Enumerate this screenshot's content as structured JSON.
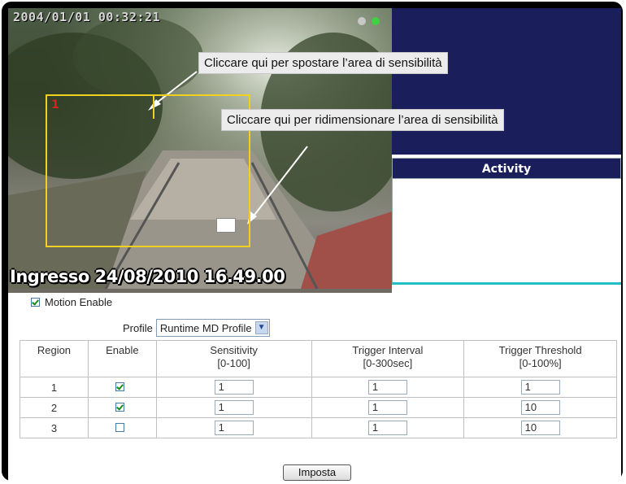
{
  "camera": {
    "timestamp": "2004/01/01 00:32:21",
    "caption": "Ingresso 24/08/2010 16.49.00",
    "region_number": "1"
  },
  "callouts": {
    "move": "Cliccare qui per spostare l’area di sensibilità",
    "resize": "Cliccare qui per ridimensionare l’area di sensibilità"
  },
  "activity": {
    "header": "Activity"
  },
  "motion": {
    "label": "Motion Enable",
    "checked": true
  },
  "profile": {
    "label": "Profile",
    "selected": "Runtime MD Profile"
  },
  "table": {
    "headers": {
      "region": "Region",
      "enable": "Enable",
      "sensitivity": "Sensitivity",
      "sensitivity_range": "[0-100]",
      "interval": "Trigger Interval",
      "interval_range": "[0-300sec]",
      "threshold": "Trigger Threshold",
      "threshold_range": "[0-100%]"
    },
    "rows": [
      {
        "region": "1",
        "enabled": true,
        "sensitivity": "1",
        "interval": "1",
        "threshold": "1"
      },
      {
        "region": "2",
        "enabled": true,
        "sensitivity": "1",
        "interval": "1",
        "threshold": "10"
      },
      {
        "region": "3",
        "enabled": false,
        "sensitivity": "1",
        "interval": "1",
        "threshold": "10"
      }
    ]
  },
  "buttons": {
    "apply": "Imposta"
  },
  "colors": {
    "navy": "#1a1f5c",
    "region_border": "#f0d020",
    "accent_line": "#20c0c0"
  }
}
